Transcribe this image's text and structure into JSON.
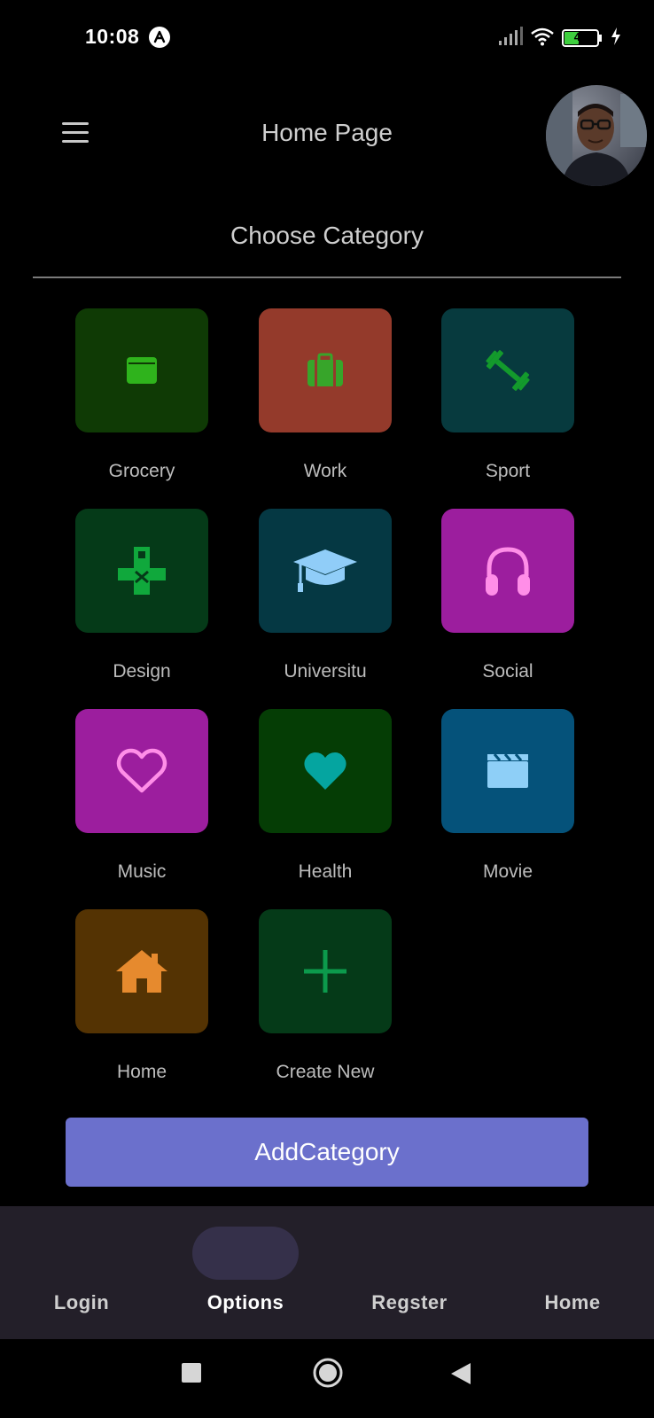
{
  "status_bar": {
    "time": "10:08",
    "battery": "43"
  },
  "app_bar": {
    "title": "Home Page"
  },
  "section_title": "Choose Category",
  "categories": [
    {
      "label": "Grocery",
      "icon": "wallet-icon",
      "bg": "#0f3a05",
      "fg": "#2fb31c"
    },
    {
      "label": "Work",
      "icon": "briefcase-icon",
      "bg": "#943a2b",
      "fg": "#37a52a"
    },
    {
      "label": "Sport",
      "icon": "dumbbell-icon",
      "bg": "#073a3e",
      "fg": "#139a2c"
    },
    {
      "label": "Design",
      "icon": "gamepad-icon",
      "bg": "#053a18",
      "fg": "#10a83c"
    },
    {
      "label": "Universitu",
      "icon": "graduation-cap-icon",
      "bg": "#053843",
      "fg": "#90cdf8"
    },
    {
      "label": "Social",
      "icon": "headphones-icon",
      "bg": "#9c1e9e",
      "fg": "#ff8ee8"
    },
    {
      "label": "Music",
      "icon": "heart-outline-icon",
      "bg": "#9c1e9e",
      "fg": "#ff8ee8"
    },
    {
      "label": "Health",
      "icon": "heart-icon",
      "bg": "#053d05",
      "fg": "#05a5a0"
    },
    {
      "label": "Movie",
      "icon": "clapperboard-icon",
      "bg": "#05527a",
      "fg": "#8ecff7"
    },
    {
      "label": "Home",
      "icon": "house-icon",
      "bg": "#543303",
      "fg": "#e68a2e"
    },
    {
      "label": "Create New",
      "icon": "plus-icon",
      "bg": "#053a18",
      "fg": "#0c9a4c"
    }
  ],
  "add_button_label": "AddCategory",
  "bottom_nav": {
    "items": [
      {
        "label": "Login"
      },
      {
        "label": "Options"
      },
      {
        "label": "Regster"
      },
      {
        "label": "Home"
      }
    ],
    "active_index": 1
  }
}
